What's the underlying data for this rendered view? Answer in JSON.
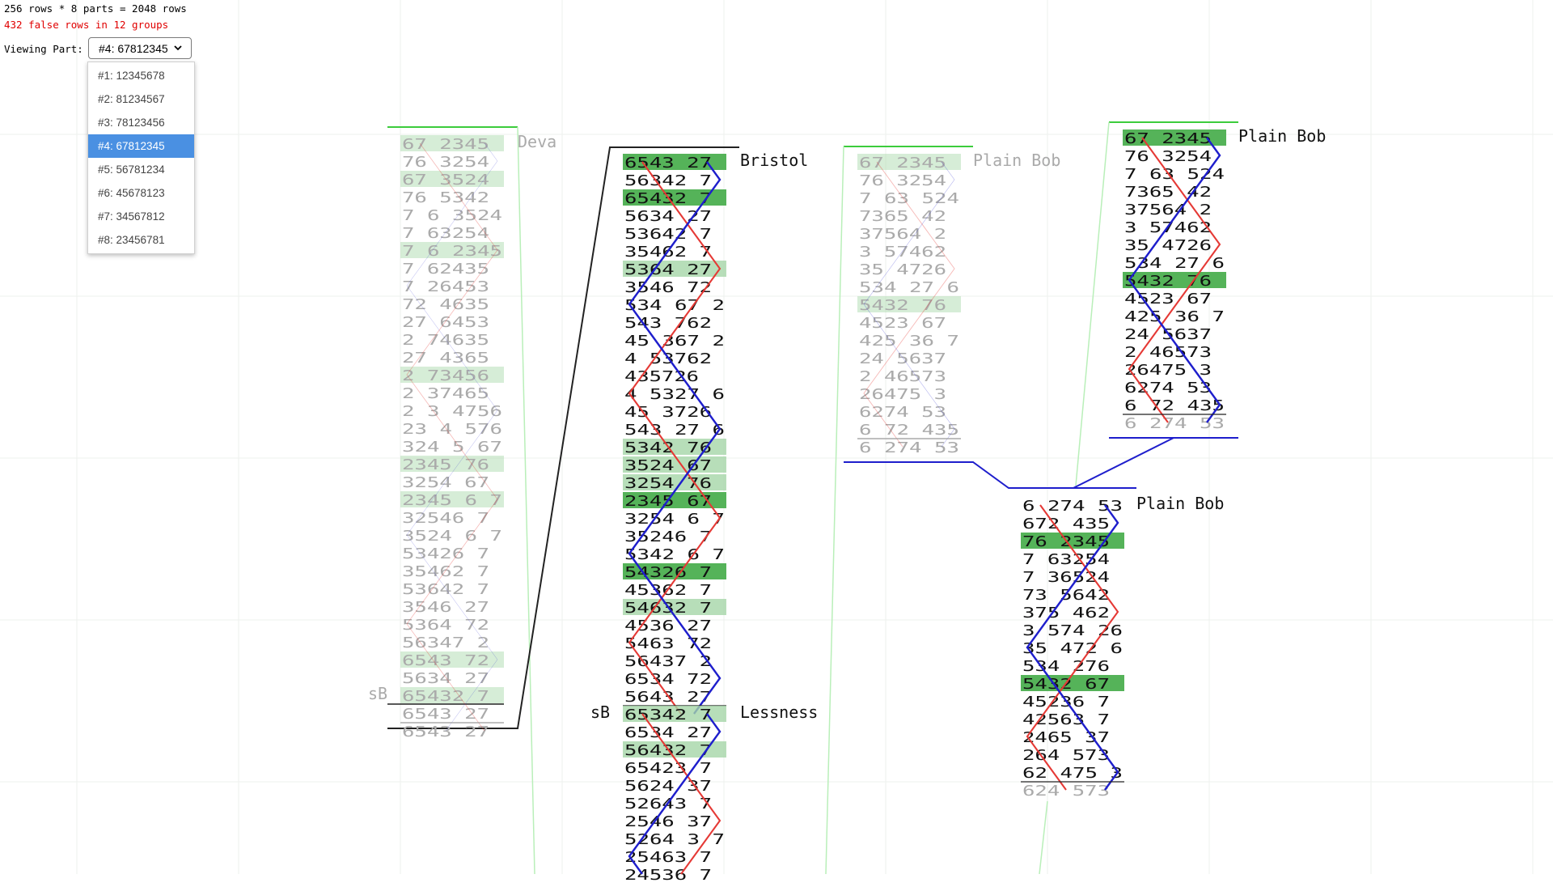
{
  "header": {
    "rows_info": "256 rows * 8 parts = 2048 rows",
    "false_info": "432 false rows in 12 groups",
    "viewing_label": "Viewing Part:",
    "selected_part": "#4: 67812345"
  },
  "parts": [
    {
      "label": "#1: 12345678"
    },
    {
      "label": "#2: 81234567"
    },
    {
      "label": "#3: 78123456"
    },
    {
      "label": "#4: 67812345",
      "selected": true
    },
    {
      "label": "#5: 56781234"
    },
    {
      "label": "#6: 45678123"
    },
    {
      "label": "#7: 34567812"
    },
    {
      "label": "#8: 23456781"
    }
  ],
  "colors": {
    "false_green": "#4caf50",
    "false_green_light": "#a5d6a7",
    "line_red": "#e53935",
    "line_blue": "#1e1ecc",
    "link_green": "#3ccc3c"
  },
  "methods": [
    {
      "id": "deva",
      "label": "Deva",
      "faded": true,
      "lead_end_label": "sB",
      "rows": [
        "67 2345",
        "76 3254",
        "67 3524",
        "76 5342",
        "7 6 3524",
        "7 63254",
        "7 6 2345",
        "7 62435",
        "7 26453",
        "72 4635",
        "27 6453",
        "2 74635",
        "27 4365",
        "2 73456",
        "2 37465",
        "2 3 4756",
        "23 4 576",
        "324 5 67",
        "2345 76",
        "3254 67",
        "2345 6 7",
        "32546 7",
        "3524 6 7",
        "53426 7",
        "35462 7",
        "53642 7",
        "3546 27",
        "5364 72",
        "56347 2",
        "6543 72",
        "5634 27",
        "65432 7",
        "6543 27"
      ],
      "last_row": "6543 27"
    },
    {
      "id": "bristol",
      "label": "Bristol",
      "faded": false,
      "rows": [
        "6543 27",
        "56342 7",
        "65432 7",
        "5634 27",
        "53642 7",
        "35462 7",
        "5364 27",
        "3546 72",
        "534 67 2",
        "543 762",
        "45 367 2",
        "4 53762",
        "435726",
        "4 5327 6",
        "45 3726",
        "543 27 6",
        "5342 76",
        "3524 67",
        "3254 76",
        "2345 67",
        "3254 6 7",
        "35246 7",
        "5342 6 7",
        "54326 7",
        "45362 7",
        "54632 7",
        "4536 27",
        "5463 72",
        "56437 2",
        "6534 72",
        "5643 27"
      ],
      "last_row": "65342 7"
    },
    {
      "id": "lessness",
      "label": "Lessness",
      "faded": false,
      "lead_end_label": "sB",
      "rows": [
        "65342 7",
        "6534 27",
        "56432 7",
        "65423 7",
        "5624 37",
        "52643 7",
        "2546 37",
        "5264 3 7",
        "25463 7",
        "24536 7"
      ]
    },
    {
      "id": "plainbob1",
      "label": "Plain Bob",
      "faded": true,
      "rows": [
        "67 2345",
        "76 3254",
        "7 63 524",
        "7365 42",
        "37564 2",
        "3 57462",
        "35 4726",
        "534 27 6",
        "5432 76",
        "4523 67",
        "425 36 7",
        "24 5637",
        "2 46573",
        "26475 3",
        "6274 53",
        "6 72 435"
      ],
      "last_row": "6 274 53"
    },
    {
      "id": "plainbob2",
      "label": "Plain Bob",
      "faded": false,
      "rows": [
        "67 2345",
        "76 3254",
        "7 63 524",
        "7365 42",
        "37564 2",
        "3 57462",
        "35 4726",
        "534 27 6",
        "5432 76",
        "4523 67",
        "425 36 7",
        "24 5637",
        "2 46573",
        "26475 3",
        "6274 53",
        "6 72 435"
      ],
      "last_row": "6 274 53"
    },
    {
      "id": "plainbob3",
      "label": "Plain Bob",
      "faded": false,
      "rows": [
        "6 274 53",
        "672 435",
        "76 2345",
        "7 63254",
        "7 36524",
        "73 5642",
        "375 462",
        "3 574 26",
        "35 472 6",
        "534 276",
        "5432 67",
        "45236 7",
        "42563 7",
        "2465 37",
        "264 573",
        "62 475 3"
      ],
      "last_row": "624 573"
    }
  ]
}
